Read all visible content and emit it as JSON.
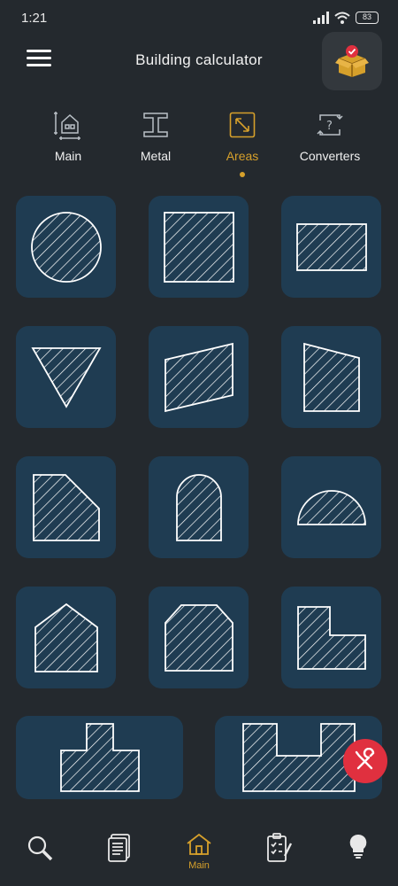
{
  "status_bar": {
    "time": "1:21",
    "battery": "83"
  },
  "header": {
    "title": "Building calculator"
  },
  "tabs": [
    {
      "label": "Main",
      "icon": "house-plan-icon"
    },
    {
      "label": "Metal",
      "icon": "i-beam-icon"
    },
    {
      "label": "Areas",
      "icon": "resize-arrows-icon",
      "active": true
    },
    {
      "label": "Converters",
      "icon": "converter-icon"
    }
  ],
  "shapes": [
    "circle",
    "square",
    "rectangle",
    "inverted-triangle",
    "parallelogram",
    "trapezoid",
    "cut-corner-square",
    "arch",
    "semicircle",
    "pentagon-house",
    "octagon-cut",
    "l-shape",
    "t-shape",
    "u-shape"
  ],
  "bottom_nav": [
    {
      "icon": "search-icon"
    },
    {
      "icon": "document-list-icon"
    },
    {
      "icon": "home-icon",
      "label": "Main"
    },
    {
      "icon": "checklist-icon"
    },
    {
      "icon": "lightbulb-icon"
    }
  ],
  "colors": {
    "accent": "#d6a02b",
    "card": "#1f3c52",
    "background": "#24292e",
    "fab": "#e0303f"
  }
}
